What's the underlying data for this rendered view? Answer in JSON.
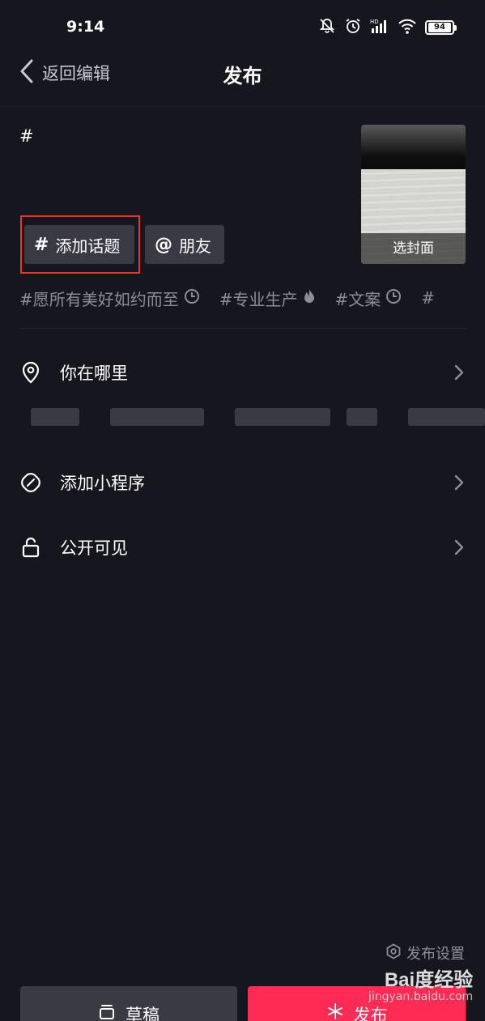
{
  "status_bar": {
    "time": "9:14",
    "battery": "94"
  },
  "header": {
    "back_label": "返回编辑",
    "title": "发布"
  },
  "caption": {
    "text": "#"
  },
  "cover": {
    "label": "选封面"
  },
  "chips": {
    "topic_icon": "#",
    "topic_label": "添加话题",
    "friend_icon": "@",
    "friend_label": "朋友"
  },
  "hashtags": [
    {
      "label": "#愿所有美好如约而至",
      "icon": "clock-icon"
    },
    {
      "label": "#专业生产",
      "icon": "fire-icon"
    },
    {
      "label": "#文案",
      "icon": "clock-icon"
    },
    {
      "label": "#",
      "icon": ""
    }
  ],
  "rows": {
    "location": "你在哪里",
    "mini_program": "添加小程序",
    "visibility": "公开可见"
  },
  "footer": {
    "settings_label": "发布设置",
    "draft_label": "草稿",
    "publish_label": "发布"
  },
  "watermark": {
    "logo": "Bai度经验",
    "url": "jingyan.baidu.com"
  },
  "colors": {
    "background": "#16161f",
    "chip": "#3a3a44",
    "publish": "#fe2c55",
    "highlight": "#e8342c",
    "muted": "#8d8d97"
  }
}
